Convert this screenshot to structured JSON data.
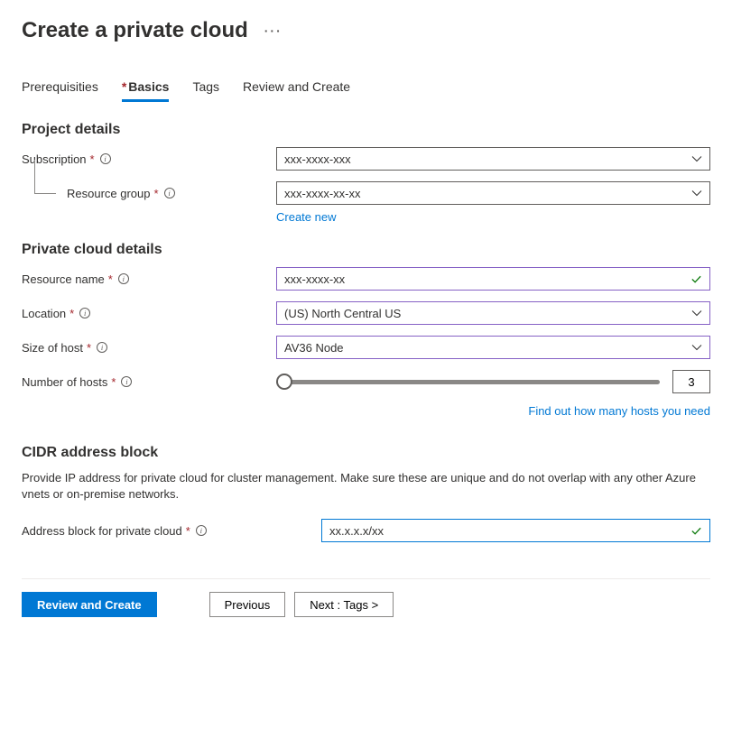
{
  "header": {
    "title": "Create a private cloud"
  },
  "tabs": {
    "prereq": "Prerequisities",
    "basics": "Basics",
    "tags": "Tags",
    "review": "Review and Create"
  },
  "project": {
    "heading": "Project details",
    "subscription_label": "Subscription",
    "subscription_value": "xxx-xxxx-xxx",
    "resource_group_label": "Resource group",
    "resource_group_value": "xxx-xxxx-xx-xx",
    "create_new": "Create new"
  },
  "cloud": {
    "heading": "Private cloud details",
    "resource_name_label": "Resource name",
    "resource_name_value": "xxx-xxxx-xx",
    "location_label": "Location",
    "location_value": "(US) North Central US",
    "host_size_label": "Size of host",
    "host_size_value": "AV36 Node",
    "num_hosts_label": "Number of hosts",
    "num_hosts_value": "3",
    "hosts_link": "Find out how many hosts you need"
  },
  "cidr": {
    "heading": "CIDR address block",
    "desc": "Provide IP address for private cloud for cluster management. Make sure these are unique and do not overlap with any other Azure vnets or on-premise networks.",
    "address_label": "Address block for private cloud",
    "address_value": "xx.x.x.x/xx"
  },
  "footer": {
    "review": "Review and Create",
    "previous": "Previous",
    "next": "Next : Tags >"
  }
}
